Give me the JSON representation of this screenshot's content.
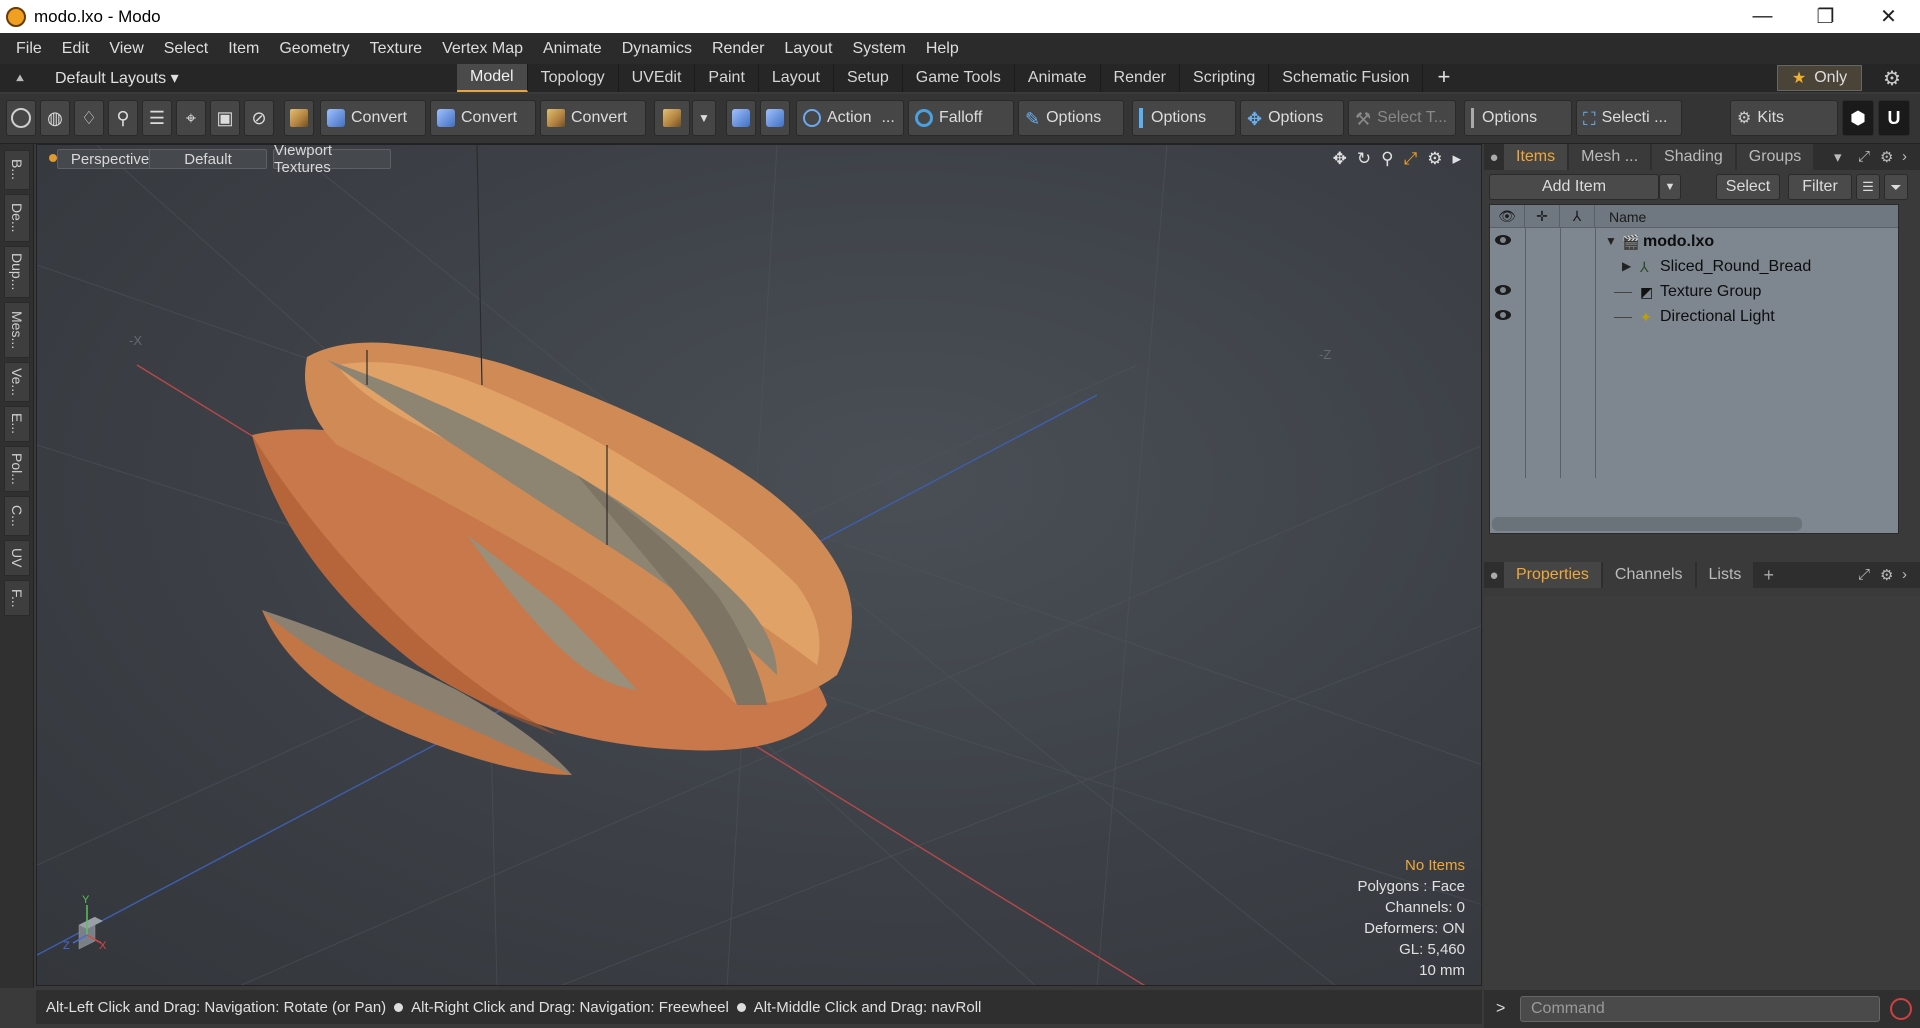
{
  "window": {
    "title": "modo.lxo - Modo",
    "minimize": "—",
    "maximize": "❐",
    "close": "✕"
  },
  "menubar": [
    "File",
    "Edit",
    "View",
    "Select",
    "Item",
    "Geometry",
    "Texture",
    "Vertex Map",
    "Animate",
    "Dynamics",
    "Render",
    "Layout",
    "System",
    "Help"
  ],
  "layouts": {
    "label": "Default Layouts ▾"
  },
  "tabs": [
    {
      "label": "Model",
      "active": true
    },
    {
      "label": "Topology"
    },
    {
      "label": "UVEdit"
    },
    {
      "label": "Paint"
    },
    {
      "label": "Layout"
    },
    {
      "label": "Setup"
    },
    {
      "label": "Game Tools"
    },
    {
      "label": "Animate"
    },
    {
      "label": "Render"
    },
    {
      "label": "Scripting"
    },
    {
      "label": "Schematic Fusion"
    }
  ],
  "tabs_add": "+",
  "only_label": "Only",
  "toolbar": {
    "convert1": "Convert",
    "convert2": "Convert",
    "convert3": "Convert",
    "action": "Action",
    "action_more": "...",
    "falloff": "Falloff",
    "options1": "Options",
    "options2": "Options",
    "options3": "Options",
    "select_t": "Select T...",
    "options4": "Options",
    "selecti": "Selecti ...",
    "kits": "Kits"
  },
  "left_tabs": [
    "B...",
    "De...",
    "Dup...",
    "Mes...",
    "Ve...",
    "E...",
    "Pol...",
    "C...",
    "UV",
    "F..."
  ],
  "viewport": {
    "view": "Perspective",
    "shading": "Default",
    "textures": "Viewport Textures",
    "axis_neg_x": "-X",
    "axis_neg_z": "-Z",
    "gizmo_y": "Y",
    "gizmo_z": "Z",
    "gizmo_x": "X",
    "info": {
      "no_items": "No Items",
      "polygons": "Polygons : Face",
      "channels": "Channels: 0",
      "deformers": "Deformers: ON",
      "gl": "GL: 5,460",
      "scale": "10 mm"
    }
  },
  "status": {
    "hint1": "Alt-Left Click and Drag: Navigation: Rotate (or Pan)",
    "hint2": "Alt-Right Click and Drag: Navigation: Freewheel",
    "hint3": "Alt-Middle Click and Drag: navRoll"
  },
  "items_panel": {
    "tabs": [
      "Items",
      "Mesh ...",
      "Shading",
      "Groups"
    ],
    "add_item": "Add Item",
    "select": "Select",
    "filter": "Filter",
    "col_name": "Name",
    "rows": [
      {
        "label": "modo.lxo",
        "level": 0,
        "bold": true,
        "eye": true
      },
      {
        "label": "Sliced_Round_Bread",
        "level": 1,
        "eye": false
      },
      {
        "label": "Texture Group",
        "level": 1,
        "eye": true
      },
      {
        "label": "Directional Light",
        "level": 1,
        "eye": true
      }
    ]
  },
  "props_panel": {
    "tabs": [
      "Properties",
      "Channels",
      "Lists"
    ],
    "add": "+"
  },
  "command": {
    "prompt": ">",
    "placeholder": "Command"
  },
  "colors": {
    "accent": "#f0a83a",
    "viewport_bg": "#3c4046",
    "list_bg": "#7e8790"
  }
}
